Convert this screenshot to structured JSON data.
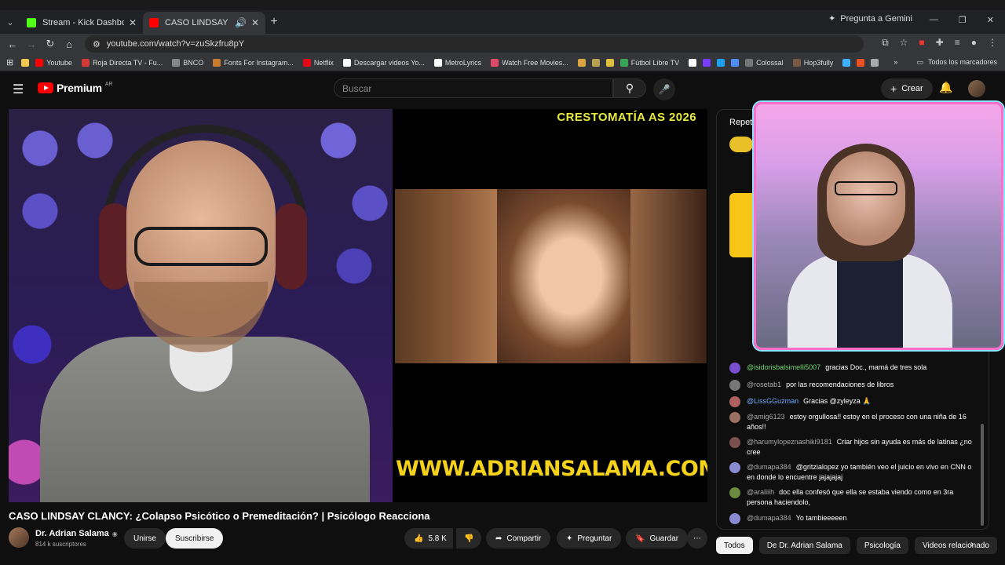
{
  "browser": {
    "tabs": [
      {
        "title": "Stream - Kick Dashboard",
        "favicon_color": "#53fc18",
        "active": false
      },
      {
        "title": "CASO LINDSAY CLANCY: ¿C",
        "favicon_color": "#ff0000",
        "active": true
      }
    ],
    "gemini_label": "Pregunta a Gemini",
    "url": "youtube.com/watch?v=zuSkzfru8pY",
    "bookmarks": [
      {
        "label": "",
        "color": "#f2c94c"
      },
      {
        "label": "Youtube",
        "color": "#ff0000"
      },
      {
        "label": "Roja Directa TV - Fu...",
        "color": "#d23a3a"
      },
      {
        "label": "BNCO",
        "color": "#888888"
      },
      {
        "label": "Fonts For Instagram...",
        "color": "#c77b2f"
      },
      {
        "label": "Netflix",
        "color": "#e50914"
      },
      {
        "label": "Descargar videos Yo...",
        "color": "#ffffff"
      },
      {
        "label": "MetroLyrics",
        "color": "#ffffff"
      },
      {
        "label": "Watch Free Movies...",
        "color": "#e04a6a"
      },
      {
        "label": "",
        "color": "#d9a441"
      },
      {
        "label": "",
        "color": "#b8a050"
      },
      {
        "label": "",
        "color": "#e0c040"
      },
      {
        "label": "Fútbol Libre TV",
        "color": "#3aa655"
      },
      {
        "label": "",
        "color": "#ffffff"
      },
      {
        "label": "",
        "color": "#7a3cff"
      },
      {
        "label": "",
        "color": "#1da1f2"
      },
      {
        "label": "",
        "color": "#4f8ff7"
      },
      {
        "label": "Colossal",
        "color": "#777777"
      },
      {
        "label": "Hop3fully",
        "color": "#7a5a40"
      },
      {
        "label": "",
        "color": "#3ab0ff"
      },
      {
        "label": "",
        "color": "#f25022"
      },
      {
        "label": "",
        "color": "#aaaaaa"
      }
    ],
    "all_bookmarks": "Todos los marcadores"
  },
  "youtube": {
    "logo_word": "Premium",
    "logo_country": "AR",
    "search_placeholder": "Buscar",
    "create_label": "Crear"
  },
  "video": {
    "overlay_top": "CRESTOMATÍA AS 2026",
    "overlay_url": "WWW.ADRIANSALAMA.COM",
    "title": "CASO LINDSAY CLANCY: ¿Colapso Psicótico o Premeditación? | Psicólogo Reacciona"
  },
  "channel": {
    "name": "Dr. Adrian Salama",
    "subscribers": "814 k suscriptores",
    "join_label": "Unirse",
    "subscribe_label": "Suscribirse"
  },
  "actions": {
    "likes": "5.8 K",
    "share": "Compartir",
    "ask": "Preguntar",
    "save": "Guardar"
  },
  "chat": {
    "header": "Repeti",
    "messages": [
      {
        "author": "@isidorisbalsimelli5007",
        "text": "gracias Doc., mamá de tres sola",
        "color": "#7a4fd0",
        "style": "green"
      },
      {
        "author": "@rosetab1",
        "text": "por las recomendaciones de libros",
        "color": "#777777",
        "style": ""
      },
      {
        "author": "@LissGGuzman",
        "text": "Gracias @zyleyza 🙏",
        "color": "#b06060",
        "style": "blue"
      },
      {
        "author": "@amig6123",
        "text": "estoy orgullosa!! estoy en el proceso con una niña de 16 años!!",
        "color": "#9a7060",
        "style": ""
      },
      {
        "author": "@harumylopeznashiki9181",
        "text": "Criar hijos sin ayuda es más de latinas ¿no cree",
        "color": "#7a5050",
        "style": ""
      },
      {
        "author": "@dumapa384",
        "text": "@gritzialopez yo también veo el juicio en vivo en CNN o en donde lo encuentre jajajajaj",
        "color": "#8a8ad0",
        "style": ""
      },
      {
        "author": "@araliiih",
        "text": "doc ella confesó que ella se estaba viendo como en 3ra persona haciendolo,",
        "color": "#6a8a40",
        "style": ""
      },
      {
        "author": "@dumapa384",
        "text": "Yo tambieeeeen",
        "color": "#8a8ad0",
        "style": ""
      }
    ]
  },
  "chips": [
    "Todos",
    "De Dr. Adrian Salama",
    "Psicología",
    "Videos relacionado"
  ]
}
